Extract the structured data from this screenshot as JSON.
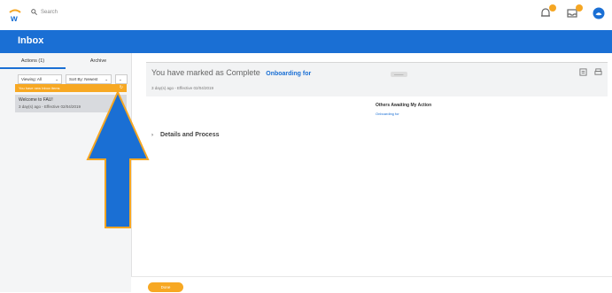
{
  "topbar": {
    "search_placeholder": "Search",
    "logo_icon": "workday-w-logo",
    "icons": [
      "bell-icon",
      "inbox-icon",
      "profile-avatar-icon"
    ],
    "badge_color": "#f5a623"
  },
  "banner": {
    "title": "Inbox",
    "color": "#1a6fd4"
  },
  "sidebar": {
    "tabs": [
      {
        "label": "Actions (1)"
      },
      {
        "label": "Archive"
      }
    ],
    "viewing": "Viewing: All",
    "sort": "Sort By: Newest",
    "notification": "You have new Inbox items",
    "item": {
      "title": "Welcome to FAU!",
      "meta": "3 day(s) ago - Effective 02/04/2019"
    }
  },
  "main": {
    "headline_prefix": "You have marked as Complete",
    "headline_link": "Onboarding for",
    "pill": "———",
    "subline": "3 day(s) ago - Effective 02/04/2019",
    "others_title": "Others Awaiting My Action",
    "others_link": "Onboarding for",
    "details_label": "Details and Process"
  },
  "footer": {
    "done_label": "Done",
    "accent": "#f7a823"
  }
}
